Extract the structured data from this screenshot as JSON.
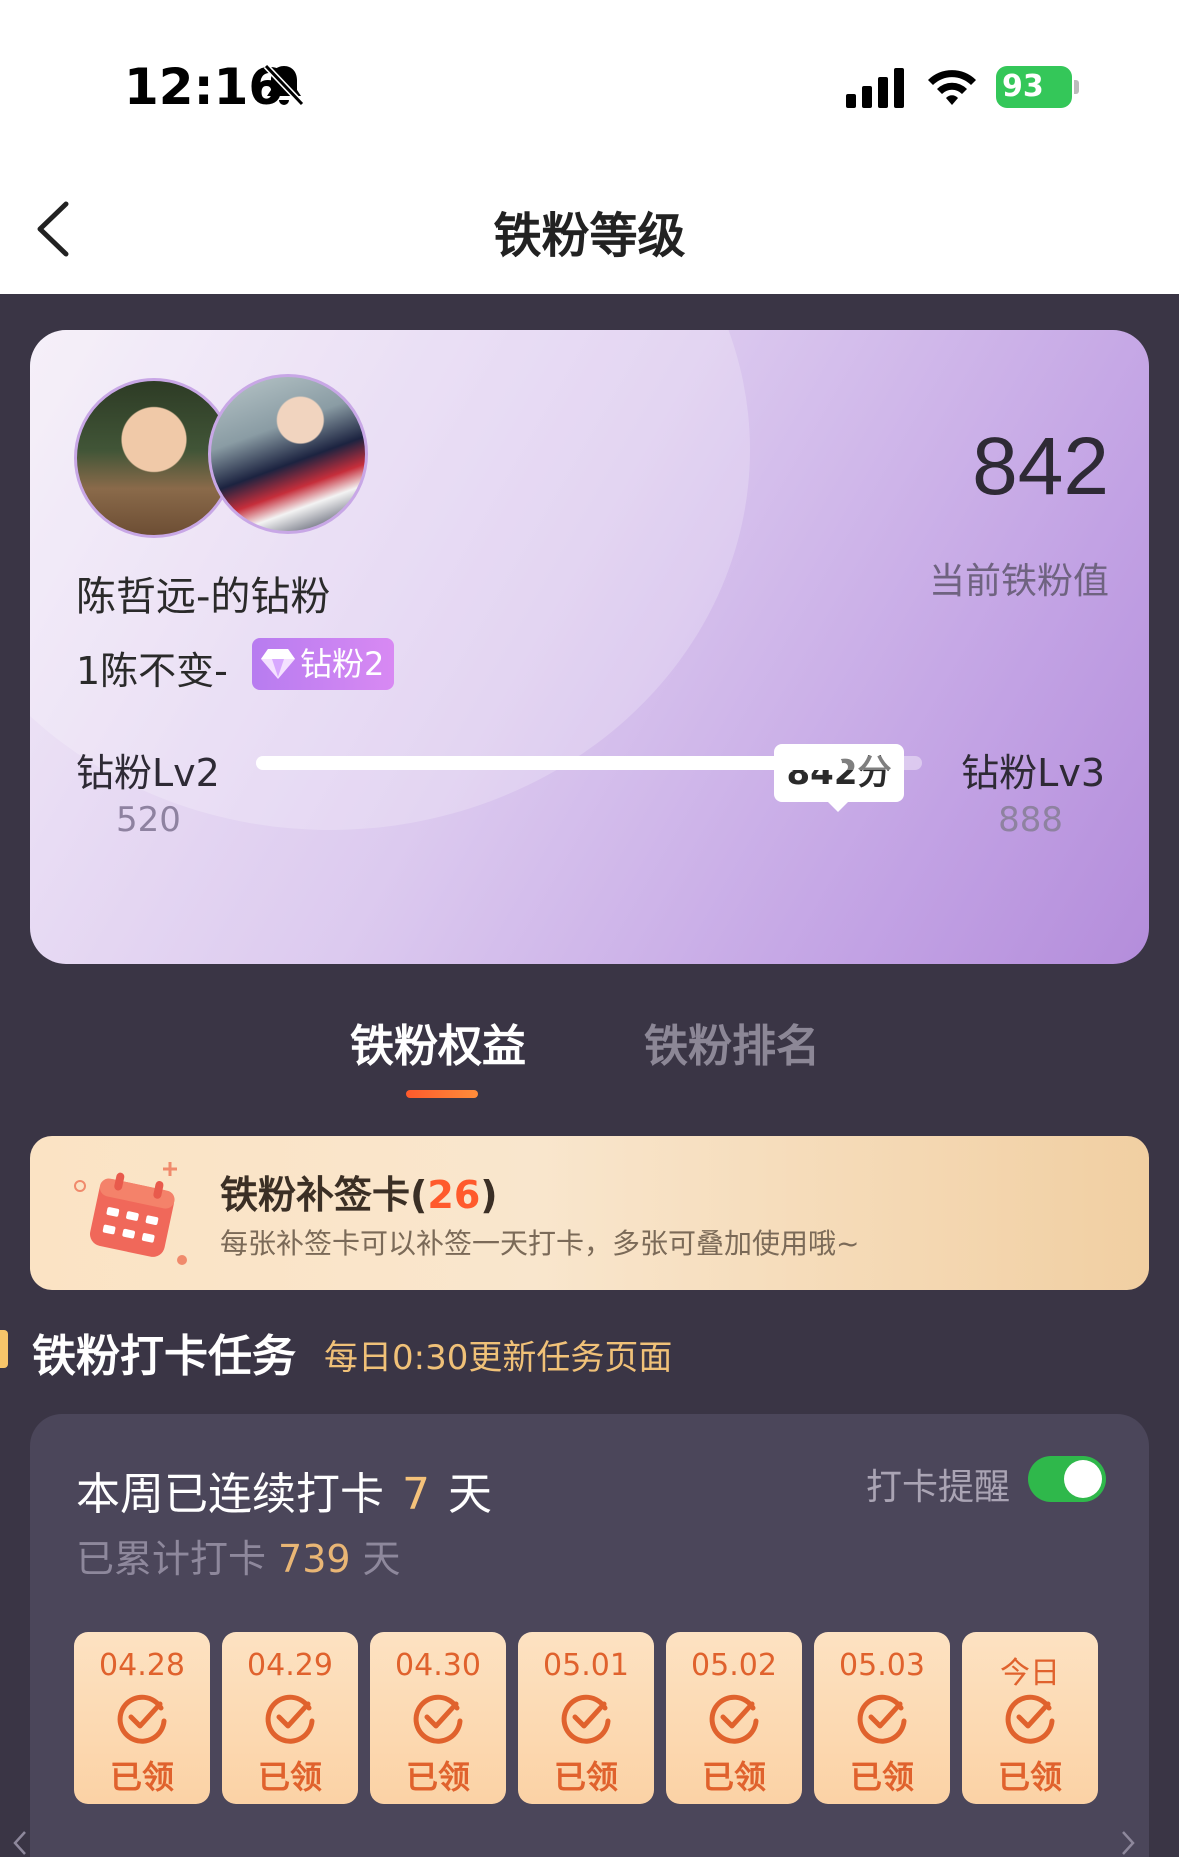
{
  "status_bar": {
    "time": "12:16",
    "battery": "93",
    "icons": [
      "bell-off-icon",
      "signal-icon",
      "wifi-icon",
      "battery-icon"
    ]
  },
  "nav": {
    "title": "铁粉等级",
    "back_icon": "back-icon"
  },
  "level_card": {
    "group_name": "陈哲远-的钻粉",
    "user_name": "1陈不变-",
    "badge_label": "钻粉2",
    "score": "842",
    "score_label": "当前铁粉值",
    "progress": {
      "tooltip": "842分",
      "current_level": "钻粉Lv2",
      "next_level": "钻粉Lv3",
      "min": "520",
      "max": "888",
      "fill_fraction": 0.88
    }
  },
  "tabs": [
    {
      "label": "铁粉权益",
      "active": true
    },
    {
      "label": "铁粉排名",
      "active": false
    }
  ],
  "supplement_card": {
    "title": "铁粉补签卡",
    "count": "26",
    "description": "每张补签卡可以补签一天打卡，多张可叠加使用哦~"
  },
  "section": {
    "title": "铁粉打卡任务",
    "subtitle": "每日0:30更新任务页面"
  },
  "checkin": {
    "streak_prefix": "本周已连续打卡",
    "streak_days": "7",
    "streak_suffix": "天",
    "total_prefix": "已累计打卡",
    "total_days": "739",
    "total_suffix": "天",
    "reminder_label": "打卡提醒",
    "reminder_on": true,
    "days": [
      {
        "date": "04.28",
        "status": "已领"
      },
      {
        "date": "04.29",
        "status": "已领"
      },
      {
        "date": "04.30",
        "status": "已领"
      },
      {
        "date": "05.01",
        "status": "已领"
      },
      {
        "date": "05.02",
        "status": "已领"
      },
      {
        "date": "05.03",
        "status": "已领"
      },
      {
        "date": "今日",
        "status": "已领"
      }
    ]
  },
  "colors": {
    "accent": "#ff5a2c",
    "dark_bg": "#3a3545",
    "toggle_on": "#2fb84b"
  }
}
